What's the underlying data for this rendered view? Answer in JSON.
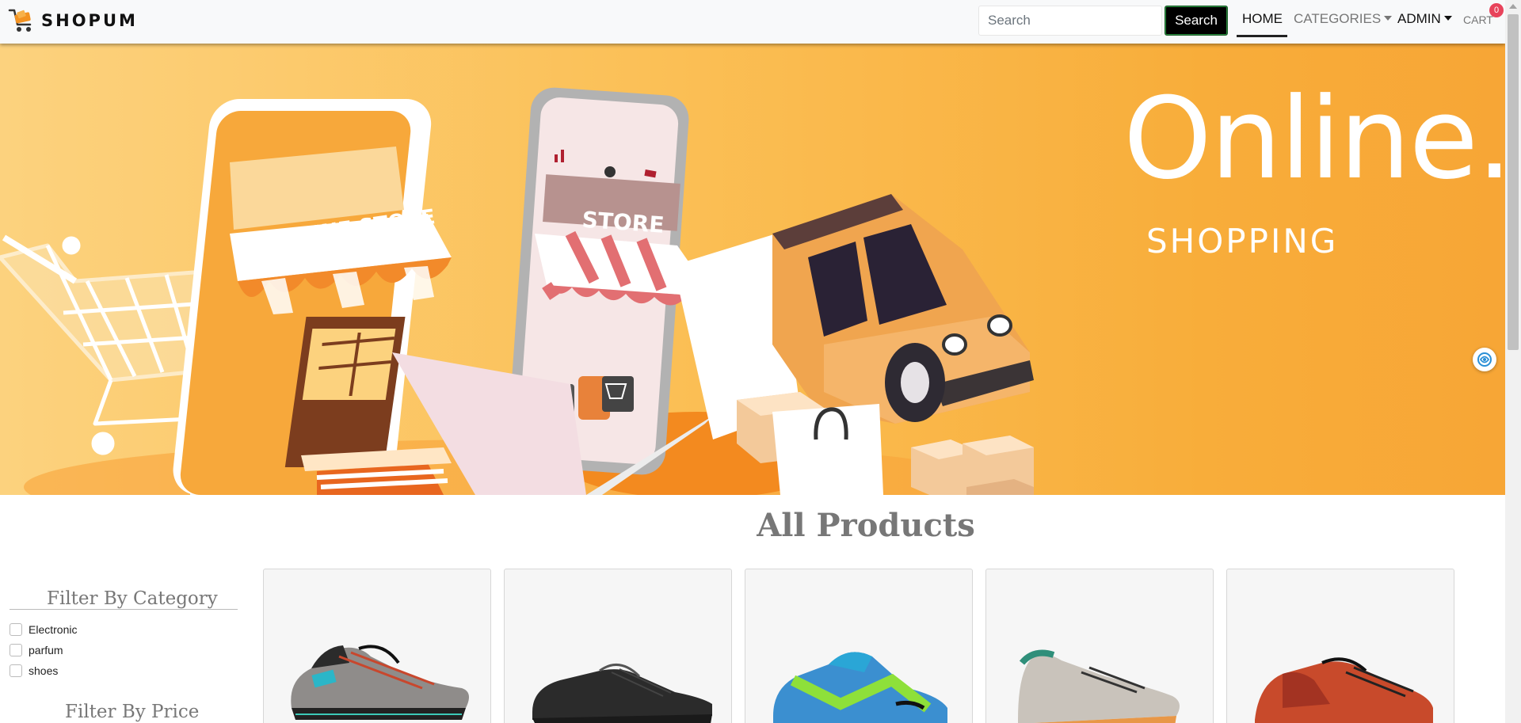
{
  "brand": {
    "name": "SHOPUM"
  },
  "search": {
    "placeholder": "Search",
    "button_label": "Search"
  },
  "nav": {
    "home": "HOME",
    "categories": "CATEGORIES",
    "admin": "ADMIN",
    "cart": "CART",
    "cart_count": "0"
  },
  "hero": {
    "title": "Online.",
    "subtitle": "SHOPPING",
    "store_sign": "ONLINE STORE",
    "phone_sign": "STORE"
  },
  "main": {
    "title": "All Products"
  },
  "filters": {
    "category_title": "Filter By Category",
    "categories": [
      {
        "label": "Electronic"
      },
      {
        "label": "parfum"
      },
      {
        "label": "shoes"
      }
    ],
    "price_title": "Filter By Price"
  },
  "products": [
    {
      "image": "sneaker-grey-teal"
    },
    {
      "image": "sneaker-black"
    },
    {
      "image": "sneaker-blue-green"
    },
    {
      "image": "sneaker-grey-orange"
    },
    {
      "image": "sneaker-red-black"
    }
  ],
  "colors": {
    "accent": "#f7a636",
    "navbar_bg": "#f8f9fa",
    "badge": "#e8435b",
    "search_button": "#000000"
  }
}
